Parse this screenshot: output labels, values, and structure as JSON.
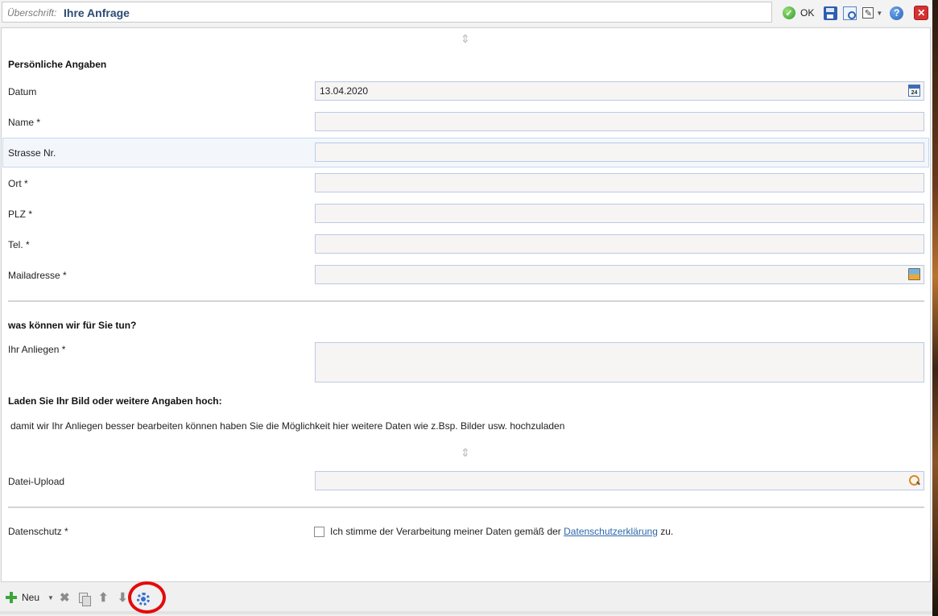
{
  "header": {
    "caption": "Überschrift:",
    "title": "Ihre Anfrage",
    "ok_label": "OK",
    "tools": [
      {
        "icon": "check-circle-icon"
      },
      {
        "icon": "save-icon"
      },
      {
        "icon": "preview-icon"
      },
      {
        "icon": "edit-icon"
      },
      {
        "icon": "help-icon"
      },
      {
        "icon": "close-icon"
      }
    ]
  },
  "form": {
    "section_personal": "Persönliche Angaben",
    "fields": {
      "datum": {
        "label": "Datum",
        "value": "13.04.2020",
        "icon": "calendar-icon"
      },
      "name": {
        "label": "Name *",
        "value": ""
      },
      "strasse": {
        "label": "Strasse Nr.",
        "value": ""
      },
      "ort": {
        "label": "Ort *",
        "value": ""
      },
      "plz": {
        "label": "PLZ *",
        "value": ""
      },
      "tel": {
        "label": "Tel. *",
        "value": ""
      },
      "mail": {
        "label": "Mailadresse *",
        "value": "",
        "icon": "image-icon"
      }
    },
    "section_request": "was können wir für Sie tun?",
    "anliegen": {
      "label": "Ihr Anliegen *",
      "value": ""
    },
    "section_upload": "Laden Sie Ihr Bild oder weitere Angaben hoch:",
    "upload_note": "damit wir Ihr Anliegen besser bearbeiten können haben Sie die Möglichkeit hier weitere Daten wie z.Bsp. Bilder usw. hochzuladen",
    "upload": {
      "label": "Datei-Upload",
      "value": "",
      "icon": "search-icon"
    },
    "privacy": {
      "label": "Datenschutz *",
      "checked": false,
      "text_before": "Ich stimme der Verarbeitung meiner Daten gemäß der ",
      "link": "Datenschutzerklärung",
      "text_after": " zu."
    }
  },
  "bottom_toolbar": {
    "new_label": "Neu",
    "tools": [
      {
        "icon": "plus-icon"
      },
      {
        "icon": "delete-icon"
      },
      {
        "icon": "copy-icon"
      },
      {
        "icon": "arrow-up-icon"
      },
      {
        "icon": "arrow-down-icon"
      },
      {
        "icon": "gear-icon"
      }
    ],
    "annotation_color": "#e30b0b"
  }
}
